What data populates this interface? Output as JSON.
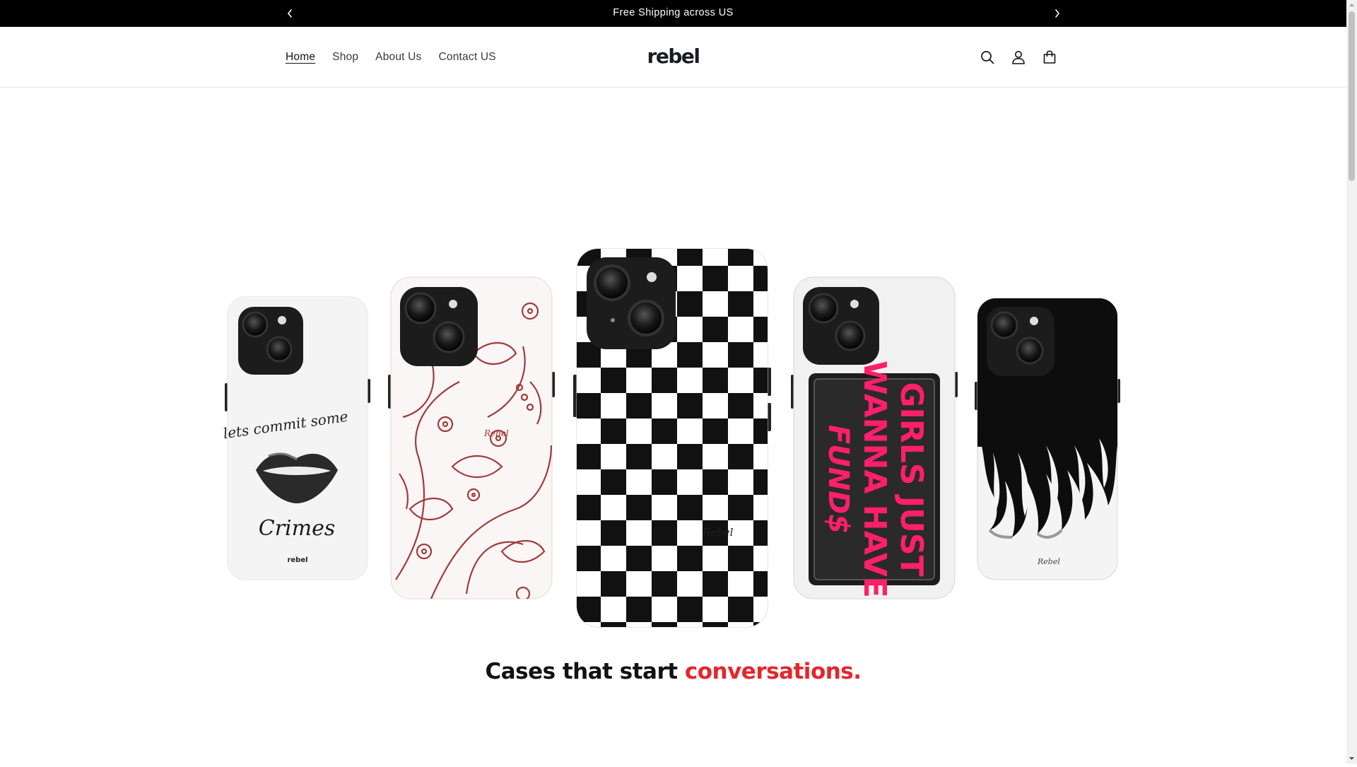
{
  "announcement": {
    "message": "Free Shipping across US",
    "prev_icon": "chevron-left-icon",
    "next_icon": "chevron-right-icon"
  },
  "header": {
    "logo": "rebel",
    "nav": [
      {
        "label": "Home",
        "active": true
      },
      {
        "label": "Shop",
        "active": false
      },
      {
        "label": "About Us",
        "active": false
      },
      {
        "label": "Contact US",
        "active": false
      }
    ],
    "icons": [
      "search-icon",
      "account-icon",
      "cart-icon"
    ]
  },
  "hero": {
    "cases": [
      {
        "design": "lips",
        "text_top": "lets commit some",
        "text_bottom": "Crimes",
        "brand": "rebel"
      },
      {
        "design": "floral-line-art",
        "signature": "Rebel"
      },
      {
        "design": "checkerboard",
        "signature": "Rebel"
      },
      {
        "design": "neon-sign",
        "text_lines": [
          "GIRLS JUST",
          "WANNA HAVE",
          "FUND$"
        ]
      },
      {
        "design": "flames",
        "signature": "Rebel"
      }
    ],
    "title_start": "Cases that start",
    "title_accent": "conversations."
  },
  "colors": {
    "announcement_bg": "#000000",
    "accent": "#e5262c",
    "neon_pink": "#ff1f6b",
    "floral_red": "#a03a3a"
  }
}
